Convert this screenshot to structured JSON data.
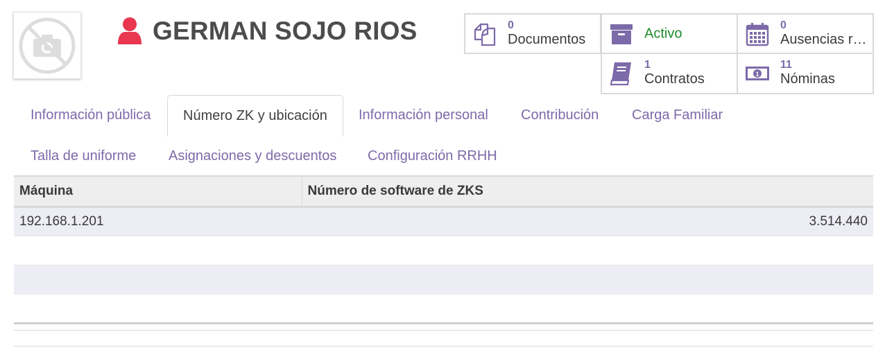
{
  "employee": {
    "name": "GERMAN SOJO RIOS"
  },
  "smart_buttons": [
    {
      "count": "0",
      "label": "Documentos",
      "icon": "documents-icon"
    },
    {
      "count": "",
      "label": "Activo",
      "icon": "archive-icon",
      "label_color": "#1e8a2a"
    },
    {
      "count": "0",
      "label": "Ausencias re...",
      "icon": "calendar-icon"
    },
    {
      "count": "1",
      "label": "Contratos",
      "icon": "book-icon"
    },
    {
      "count": "11",
      "label": "Nóminas",
      "icon": "money-icon"
    }
  ],
  "tabs": [
    {
      "label": "Información pública"
    },
    {
      "label": "Número ZK y ubicación",
      "active": true
    },
    {
      "label": "Información personal"
    },
    {
      "label": "Contribución"
    },
    {
      "label": "Carga Familiar"
    },
    {
      "label": "Talla de uniforme"
    },
    {
      "label": "Asignaciones y descuentos"
    },
    {
      "label": "Configuración RRHH"
    }
  ],
  "table": {
    "columns": [
      "Máquina",
      "Número de software de ZKS"
    ],
    "rows": [
      [
        "192.168.1.201",
        "3.514.440"
      ]
    ]
  },
  "colors": {
    "accent": "#7c6aa9",
    "user_icon": "#e8374f",
    "active_green": "#1e8a2a"
  }
}
